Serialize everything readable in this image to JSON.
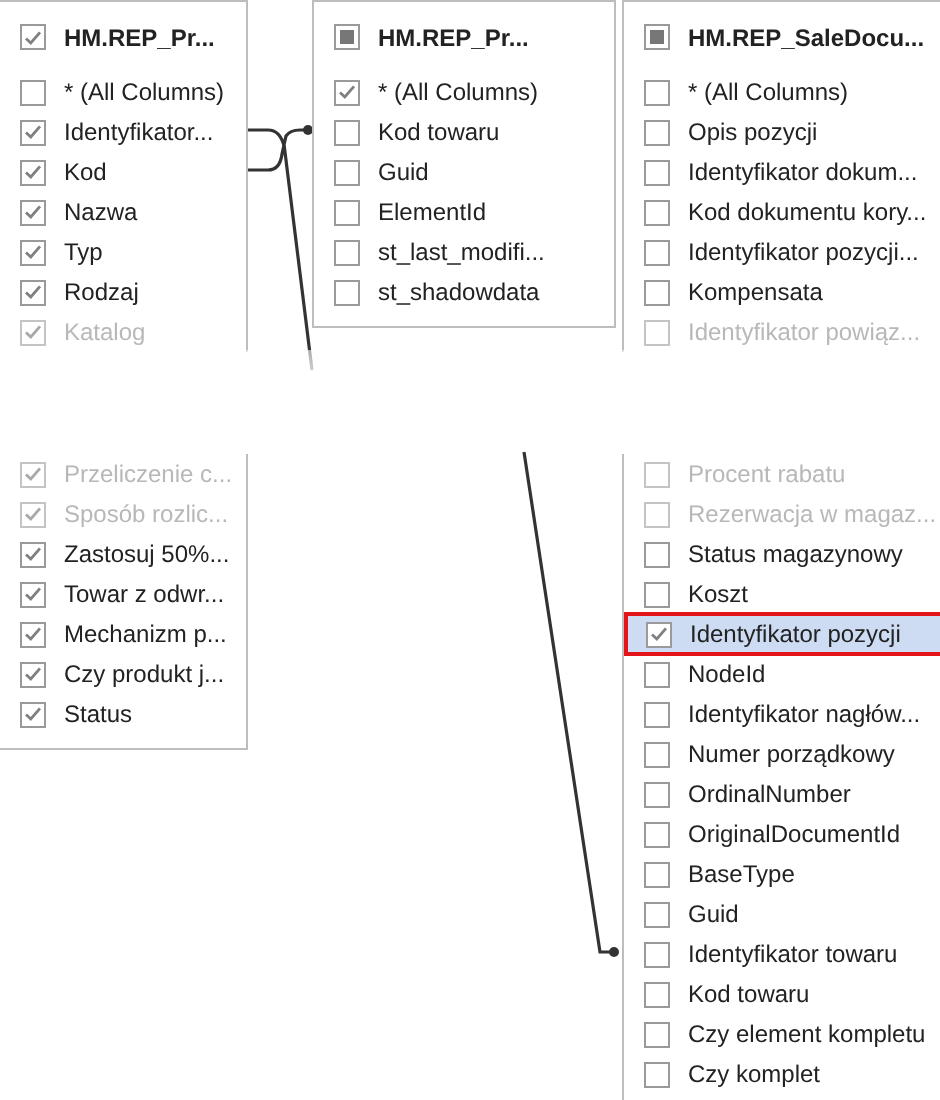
{
  "tables": [
    {
      "title": "HM.REP_Pr...",
      "checked": true,
      "items": [
        {
          "kind": "column",
          "name": "* (All Columns)",
          "checked": false,
          "faded": false,
          "selected": false
        },
        {
          "kind": "column",
          "name": "Identyfikator...",
          "checked": true,
          "faded": false,
          "selected": false
        },
        {
          "kind": "column",
          "name": "Kod",
          "checked": true,
          "faded": false,
          "selected": false
        },
        {
          "kind": "column",
          "name": "Nazwa",
          "checked": true,
          "faded": false,
          "selected": false
        },
        {
          "kind": "column",
          "name": "Typ",
          "checked": true,
          "faded": false,
          "selected": false
        },
        {
          "kind": "column",
          "name": "Rodzaj",
          "checked": true,
          "faded": false,
          "selected": false
        },
        {
          "kind": "column",
          "name": "Katalog",
          "checked": true,
          "faded": true,
          "selected": false
        },
        {
          "kind": "break"
        },
        {
          "kind": "column",
          "name": "Przeliczenie c...",
          "checked": true,
          "faded": true,
          "selected": false
        },
        {
          "kind": "column",
          "name": "Sposób rozlic...",
          "checked": true,
          "faded": true,
          "selected": false
        },
        {
          "kind": "column",
          "name": "Zastosuj 50%...",
          "checked": true,
          "faded": false,
          "selected": false
        },
        {
          "kind": "column",
          "name": "Towar z odwr...",
          "checked": true,
          "faded": false,
          "selected": false
        },
        {
          "kind": "column",
          "name": "Mechanizm p...",
          "checked": true,
          "faded": false,
          "selected": false
        },
        {
          "kind": "column",
          "name": "Czy produkt j...",
          "checked": true,
          "faded": false,
          "selected": false
        },
        {
          "kind": "column",
          "name": "Status",
          "checked": true,
          "faded": false,
          "selected": false
        }
      ]
    },
    {
      "title": "HM.REP_Pr...",
      "checked": false,
      "indeterminate": true,
      "items": [
        {
          "kind": "column",
          "name": "* (All Columns)",
          "checked": true,
          "faded": false,
          "selected": false
        },
        {
          "kind": "column",
          "name": "Kod towaru",
          "checked": false,
          "faded": false,
          "selected": false
        },
        {
          "kind": "column",
          "name": "Guid",
          "checked": false,
          "faded": false,
          "selected": false
        },
        {
          "kind": "column",
          "name": "ElementId",
          "checked": false,
          "faded": false,
          "selected": false
        },
        {
          "kind": "column",
          "name": "st_last_modifi...",
          "checked": false,
          "faded": false,
          "selected": false
        },
        {
          "kind": "column",
          "name": "st_shadowdata",
          "checked": false,
          "faded": false,
          "selected": false
        }
      ]
    },
    {
      "title": "HM.REP_SaleDocu...",
      "checked": false,
      "indeterminate": true,
      "items": [
        {
          "kind": "column",
          "name": "* (All Columns)",
          "checked": false,
          "faded": false,
          "selected": false
        },
        {
          "kind": "column",
          "name": "Opis pozycji",
          "checked": false,
          "faded": false,
          "selected": false
        },
        {
          "kind": "column",
          "name": "Identyfikator dokum...",
          "checked": false,
          "faded": false,
          "selected": false
        },
        {
          "kind": "column",
          "name": "Kod dokumentu kory...",
          "checked": false,
          "faded": false,
          "selected": false
        },
        {
          "kind": "column",
          "name": "Identyfikator pozycji...",
          "checked": false,
          "faded": false,
          "selected": false
        },
        {
          "kind": "column",
          "name": "Kompensata",
          "checked": false,
          "faded": false,
          "selected": false
        },
        {
          "kind": "column",
          "name": "Identyfikator powiąz...",
          "checked": false,
          "faded": true,
          "selected": false
        },
        {
          "kind": "break"
        },
        {
          "kind": "column",
          "name": "Procent rabatu",
          "checked": false,
          "faded": true,
          "selected": false
        },
        {
          "kind": "column",
          "name": "Rezerwacja w magaz...",
          "checked": false,
          "faded": true,
          "selected": false
        },
        {
          "kind": "column",
          "name": "Status magazynowy",
          "checked": false,
          "faded": false,
          "selected": false
        },
        {
          "kind": "column",
          "name": "Koszt",
          "checked": false,
          "faded": false,
          "selected": false
        },
        {
          "kind": "column",
          "name": "Identyfikator pozycji",
          "checked": true,
          "faded": false,
          "selected": true
        },
        {
          "kind": "column",
          "name": "NodeId",
          "checked": false,
          "faded": false,
          "selected": false
        },
        {
          "kind": "column",
          "name": "Identyfikator nagłów...",
          "checked": false,
          "faded": false,
          "selected": false
        },
        {
          "kind": "column",
          "name": "Numer porządkowy",
          "checked": false,
          "faded": false,
          "selected": false
        },
        {
          "kind": "column",
          "name": "OrdinalNumber",
          "checked": false,
          "faded": false,
          "selected": false
        },
        {
          "kind": "column",
          "name": "OriginalDocumentId",
          "checked": false,
          "faded": false,
          "selected": false
        },
        {
          "kind": "column",
          "name": "BaseType",
          "checked": false,
          "faded": false,
          "selected": false
        },
        {
          "kind": "column",
          "name": "Guid",
          "checked": false,
          "faded": false,
          "selected": false
        },
        {
          "kind": "column",
          "name": "Identyfikator towaru",
          "checked": false,
          "faded": false,
          "selected": false
        },
        {
          "kind": "column",
          "name": "Kod towaru",
          "checked": false,
          "faded": false,
          "selected": false
        },
        {
          "kind": "column",
          "name": "Czy element kompletu",
          "checked": false,
          "faded": false,
          "selected": false
        },
        {
          "kind": "column",
          "name": "Czy komplet",
          "checked": false,
          "faded": false,
          "selected": false
        }
      ]
    }
  ]
}
